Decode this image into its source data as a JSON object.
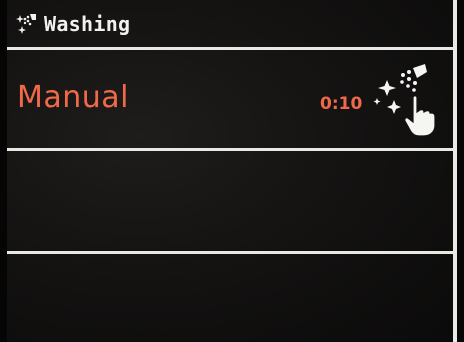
{
  "header": {
    "title": "Washing",
    "icon": "spray-sparkle-icon"
  },
  "programs": [
    {
      "name": "Manual",
      "duration": "0:10",
      "icon": "spray-touch-icon",
      "color": "#f06a4a"
    }
  ],
  "colors": {
    "background": "#141312",
    "divider": "#e8e8e4",
    "accent": "#f06a4a",
    "header_text": "#f1f1ee"
  }
}
